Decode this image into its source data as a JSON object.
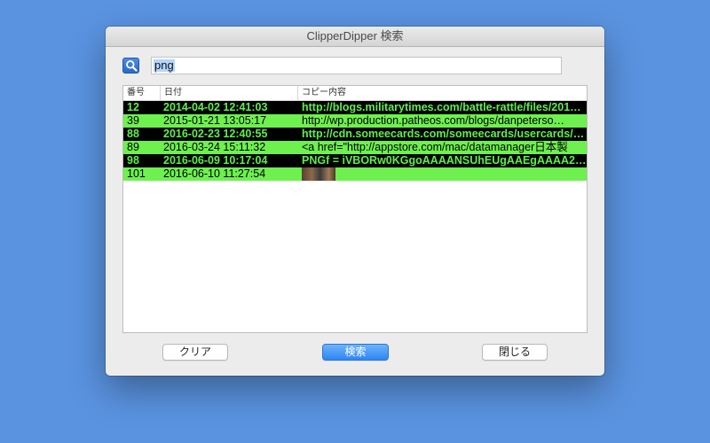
{
  "window": {
    "title": "ClipperDipper 検索"
  },
  "search": {
    "value": "png",
    "button_icon": "magnifier-icon"
  },
  "table": {
    "columns": [
      "番号",
      "日付",
      "コピー内容"
    ],
    "rows": [
      {
        "num": "12",
        "date": "2014-04-02 12:41:03",
        "content": "http://blogs.militarytimes.com/battle-rattle/files/201…",
        "style": "dark"
      },
      {
        "num": "39",
        "date": "2015-01-21 13:05:17",
        "content": "http://wp.production.patheos.com/blogs/danpeterso…",
        "style": "light"
      },
      {
        "num": "88",
        "date": "2016-02-23 12:40:55",
        "content": "http://cdn.someecards.com/someecards/usercards/1…",
        "style": "dark"
      },
      {
        "num": "89",
        "date": "2016-03-24 15:11:32",
        "content": "<a href=\"http://appstore.com/mac/datamanager日本製",
        "style": "light"
      },
      {
        "num": "98",
        "date": "2016-06-09 10:17:04",
        "content": "PNGf = iVBORw0KGgoAAAANSUhEUgAAEgAAAA2AC…",
        "style": "dark"
      },
      {
        "num": "101",
        "date": "2016-06-10 11:27:54",
        "content": "",
        "style": "light",
        "thumbnail": true
      }
    ]
  },
  "buttons": {
    "clear": "クリア",
    "search": "検索",
    "close": "閉じる"
  },
  "colors": {
    "desktop": "#5a93e0",
    "row_dark": "#000000",
    "row_light": "#6ef04f",
    "text_green": "#5ef04a",
    "accent": "#2f86f4"
  }
}
